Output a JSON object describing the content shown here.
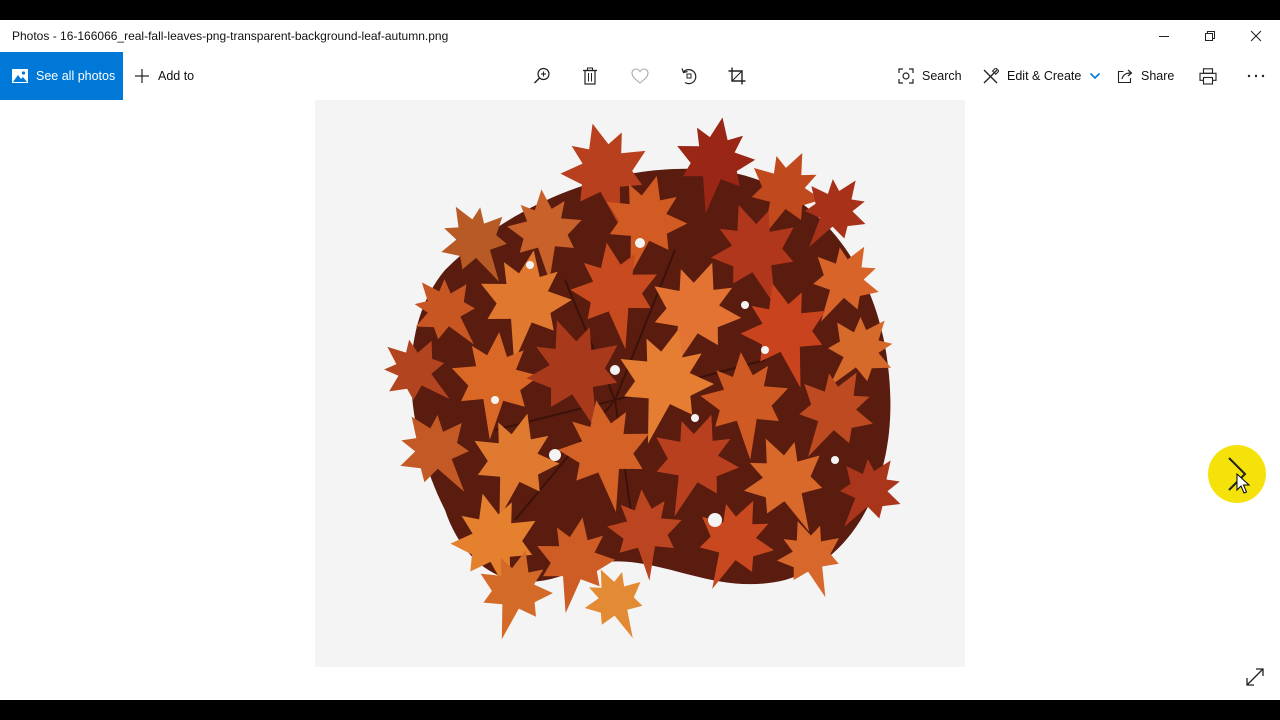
{
  "window": {
    "title": "Photos - 16-166066_real-fall-leaves-png-transparent-background-leaf-autumn.png"
  },
  "titlebar_buttons": {
    "minimize": "minimize-icon",
    "restore": "restore-icon",
    "close": "close-icon"
  },
  "toolbar": {
    "see_all_label": "See all photos",
    "add_to_label": "Add to",
    "search_label": "Search",
    "edit_create_label": "Edit & Create",
    "share_label": "Share",
    "icons": [
      "zoom-in-icon",
      "delete-icon",
      "favorite-heart-icon",
      "rotate-icon",
      "crop-icon",
      "print-icon",
      "more-options-icon"
    ]
  },
  "viewer": {
    "photo_subject": "autumn maple leaves",
    "highlight_color": "#f4e20a",
    "accent_color": "#0078d7"
  }
}
